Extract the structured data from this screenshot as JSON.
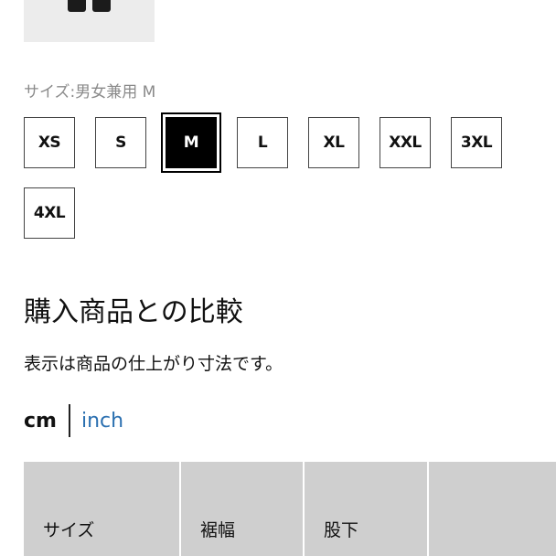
{
  "size_selector": {
    "caption": "サイズ:男女兼用 M",
    "options": [
      "XS",
      "S",
      "M",
      "L",
      "XL",
      "XXL",
      "3XL",
      "4XL"
    ],
    "selected": "M"
  },
  "compare": {
    "title": "購入商品との比較",
    "note": "表示は商品の仕上がり寸法です。"
  },
  "units": {
    "cm": "cm",
    "inch": "inch",
    "active": "cm",
    "inch_color": "#2a6fb0"
  },
  "table": {
    "headers": [
      "サイズ",
      "裾幅",
      "股下",
      ""
    ]
  }
}
